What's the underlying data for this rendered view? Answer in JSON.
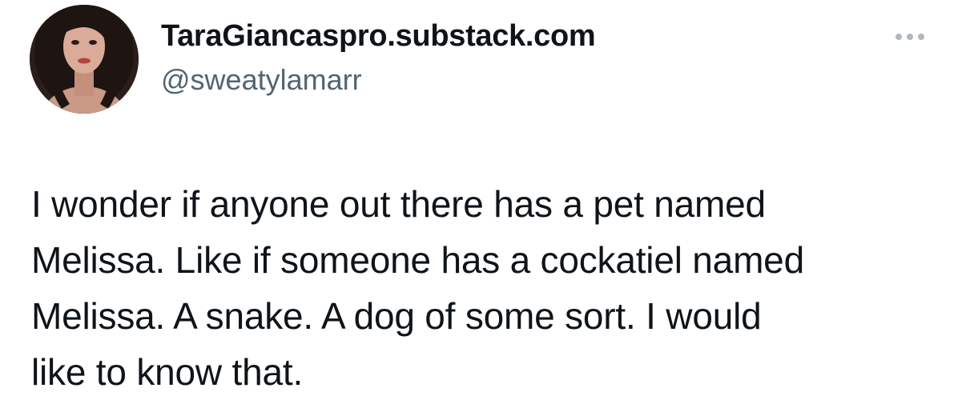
{
  "author": {
    "display_name": "TaraGiancaspro.substack.com",
    "handle": "@sweatylamarr",
    "avatar_icon": "profile-photo"
  },
  "menu": {
    "icon": "more-options-icon"
  },
  "tweet": {
    "lines": [
      "I wonder if anyone out there has a pet named",
      "Melissa. Like if someone has a cockatiel named",
      "Melissa. A snake. A dog of some sort. I would",
      "like to know that."
    ]
  },
  "colors": {
    "text": "#0f1419",
    "secondary": "#536471",
    "background": "#ffffff"
  }
}
